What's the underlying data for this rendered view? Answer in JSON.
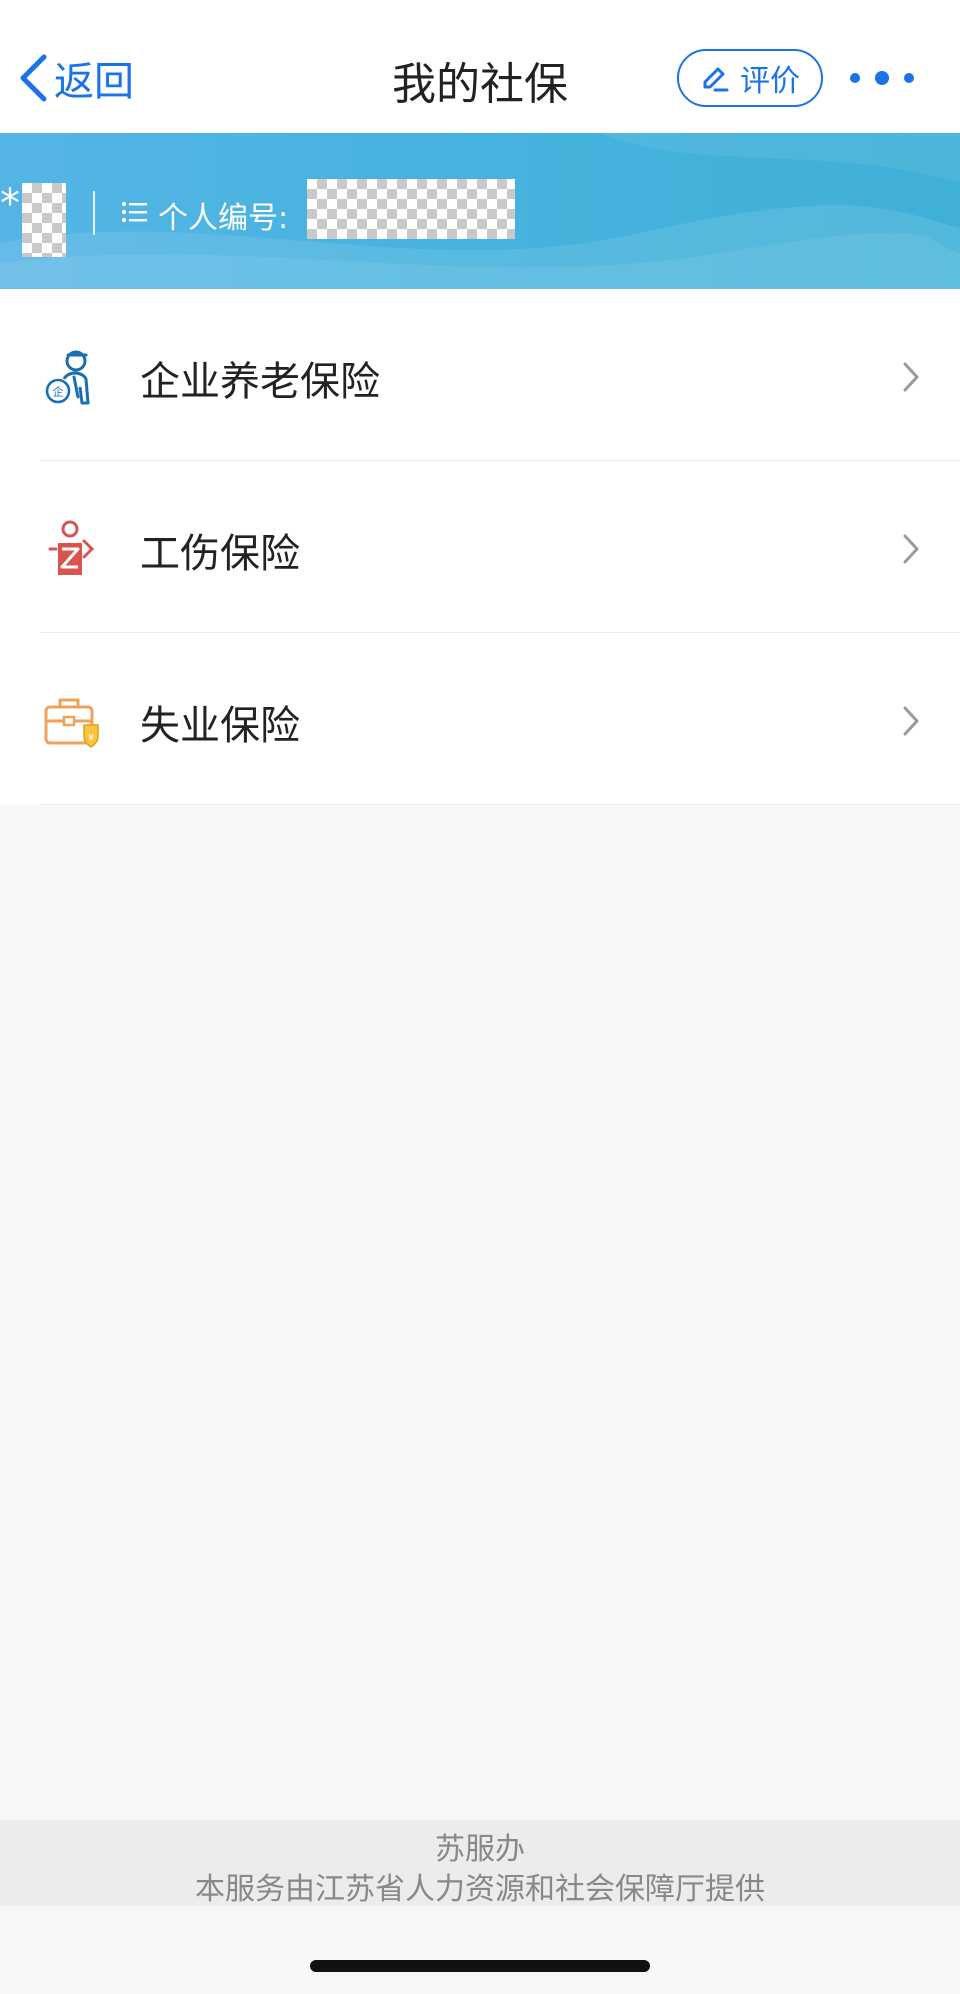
{
  "nav": {
    "back_label": "返回",
    "title": "我的社保",
    "rate_label": "评价"
  },
  "banner": {
    "name_prefix": "*",
    "id_label": "个人编号:"
  },
  "insurance_items": [
    {
      "label": "企业养老保险",
      "icon": "pension-insurance-icon",
      "color": "#1a6fb3"
    },
    {
      "label": "工伤保险",
      "icon": "work-injury-insurance-icon",
      "color": "#d9534f"
    },
    {
      "label": "失业保险",
      "icon": "unemployment-insurance-icon",
      "color": "#f0a15b"
    }
  ],
  "footer": {
    "brand": "苏服办",
    "provider": "本服务由江苏省人力资源和社会保障厅提供"
  },
  "colors": {
    "accent": "#1a73e8",
    "banner": "#47b3de"
  }
}
